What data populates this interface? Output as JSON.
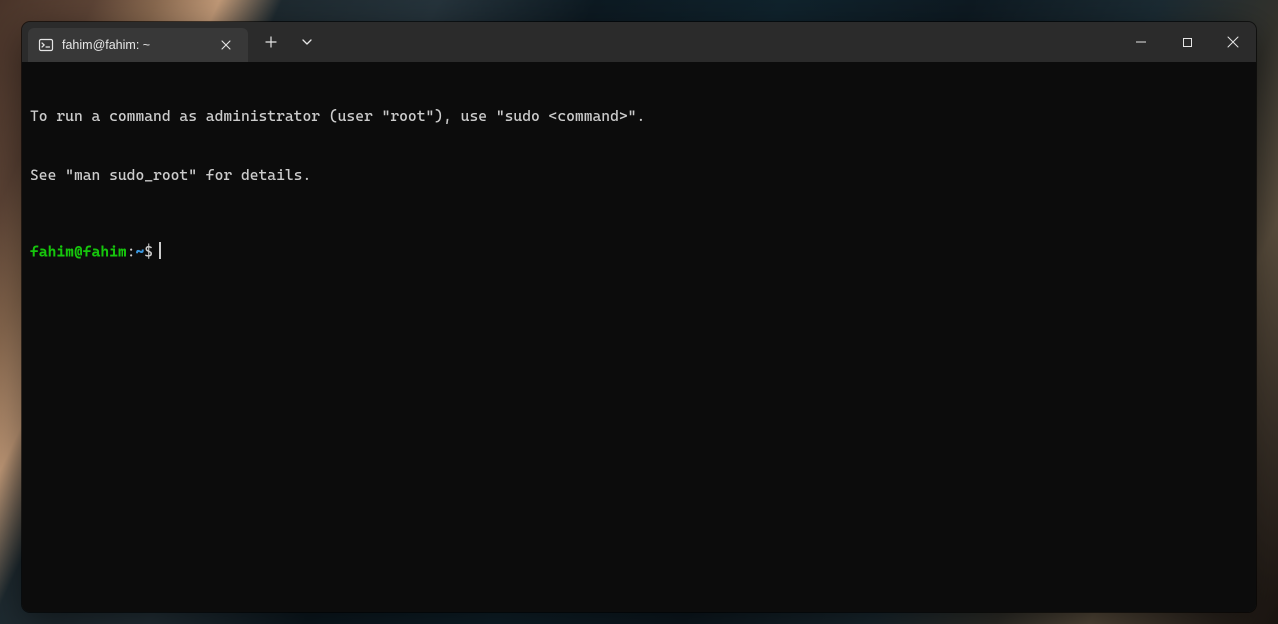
{
  "tab": {
    "title": "fahim@fahim: ~"
  },
  "terminal": {
    "motd_line1": "To run a command as administrator (user \"root\"), use \"sudo <command>\".",
    "motd_line2": "See \"man sudo_root\" for details.",
    "prompt": {
      "user_host": "fahim@fahim",
      "separator": ":",
      "path": "~",
      "symbol": "$"
    }
  }
}
